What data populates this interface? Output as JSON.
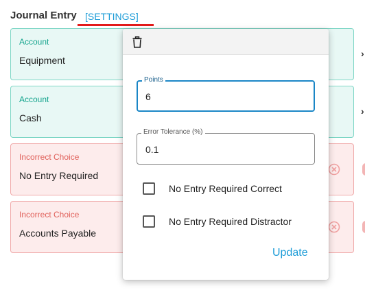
{
  "header": {
    "title": "Journal Entry",
    "settings_link": "[SETTINGS]"
  },
  "cards": [
    {
      "label": "Account",
      "value": "Equipment",
      "kind": "account"
    },
    {
      "label": "Account",
      "value": "Cash",
      "kind": "account"
    },
    {
      "label": "Incorrect Choice",
      "value": "No Entry Required",
      "kind": "incorrect"
    },
    {
      "label": "Incorrect Choice",
      "value": "Accounts Payable",
      "kind": "incorrect"
    }
  ],
  "popup": {
    "delete_icon": "trash-icon",
    "points": {
      "label": "Points",
      "value": "6"
    },
    "error_tolerance": {
      "label": "Error Tolerance (%)",
      "value": "0.1"
    },
    "checkboxes": [
      {
        "label": "No Entry Required Correct",
        "checked": false
      },
      {
        "label": "No Entry Required Distractor",
        "checked": false
      }
    ],
    "update_label": "Update"
  },
  "colors": {
    "accent": "#1a9bd7",
    "underline": "#e31b1b",
    "account_bg": "#e8f8f5",
    "account_label": "#16a58e",
    "incorrect_bg": "#fdecec",
    "incorrect_label": "#e0605a"
  }
}
